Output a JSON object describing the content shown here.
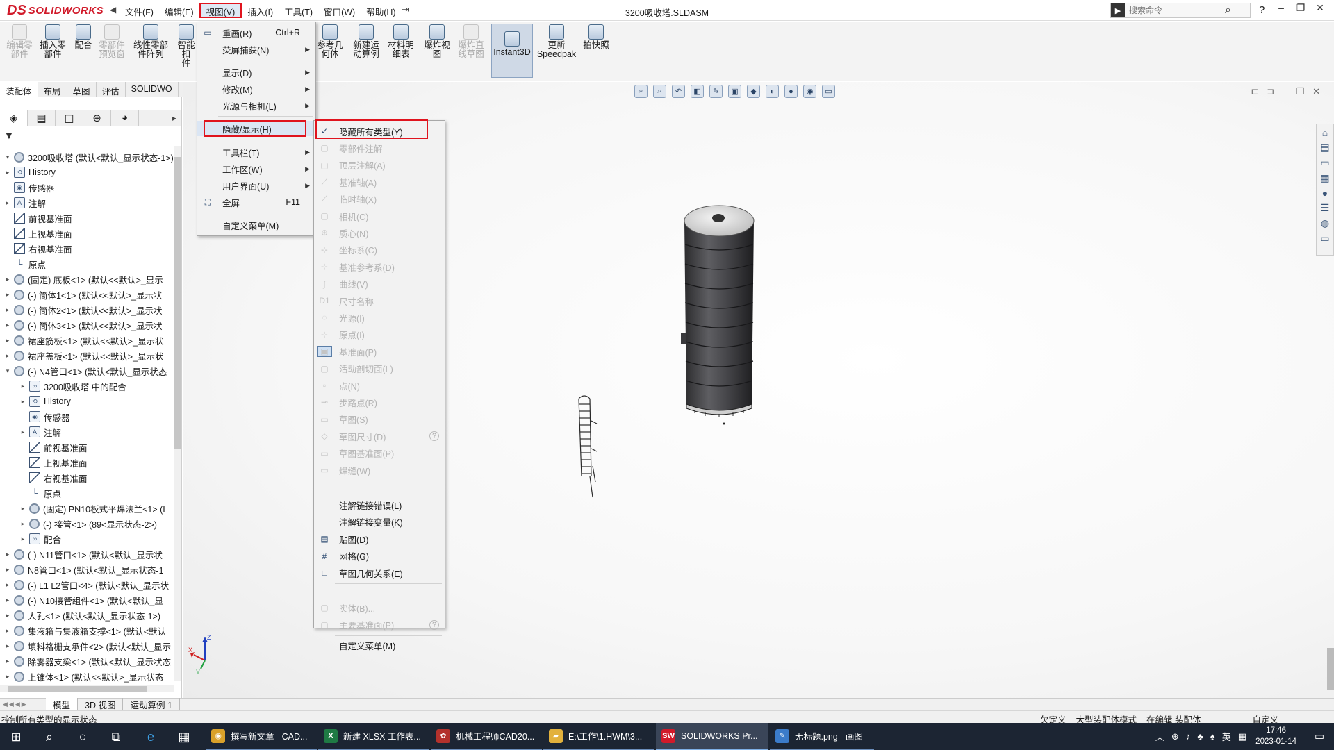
{
  "app": {
    "logo_ds": "DS",
    "logo_text": "SOLIDWORKS",
    "document_title": "3200吸收塔.SLDASM",
    "search_placeholder": "搜索命令",
    "menus": [
      "文件(F)",
      "编辑(E)",
      "视图(V)",
      "插入(I)",
      "工具(T)",
      "窗口(W)",
      "帮助(H)"
    ],
    "active_menu": "视图(V)"
  },
  "toolbar": {
    "tools": [
      {
        "label1": "编辑零",
        "label2": "部件",
        "disabled": true
      },
      {
        "label1": "插入零",
        "label2": "部件",
        "disabled": false
      },
      {
        "label1": "配合",
        "label2": "",
        "disabled": false
      },
      {
        "label1": "零部件",
        "label2": "预览窗",
        "disabled": true
      },
      {
        "label1": "线性零部",
        "label2": "件阵列",
        "disabled": false
      },
      {
        "label1": "智能扣",
        "label2": "件",
        "disabled": false
      },
      {
        "label1": "参考几",
        "label2": "何体",
        "disabled": false
      },
      {
        "label1": "新建运",
        "label2": "动算例",
        "disabled": false
      },
      {
        "label1": "材料明",
        "label2": "细表",
        "disabled": false
      },
      {
        "label1": "爆炸视",
        "label2": "图",
        "disabled": false
      },
      {
        "label1": "爆炸直",
        "label2": "线草图",
        "disabled": true
      },
      {
        "label1": "Instant3D",
        "label2": "",
        "disabled": false,
        "pressed": true
      },
      {
        "label1": "更新",
        "label2": "Speedpak",
        "disabled": false
      },
      {
        "label1": "拍快照",
        "label2": "",
        "disabled": false
      }
    ],
    "tabs": [
      "装配体",
      "布局",
      "草图",
      "评估",
      "SOLIDWO"
    ]
  },
  "view_menu": {
    "items": [
      {
        "label": "重画(R)",
        "shortcut": "Ctrl+R",
        "icon": "redraw-icon"
      },
      {
        "label": "荧屏捕获(N)",
        "submenu": true
      },
      {
        "label": "显示(D)",
        "submenu": true
      },
      {
        "label": "修改(M)",
        "submenu": true
      },
      {
        "label": "光源与相机(L)",
        "submenu": true
      },
      {
        "label": "隐藏/显示(H)",
        "submenu": false,
        "highlighted": true
      },
      {
        "label": "工具栏(T)",
        "submenu": true
      },
      {
        "label": "工作区(W)",
        "submenu": true
      },
      {
        "label": "用户界面(U)",
        "submenu": true
      },
      {
        "label": "全屏",
        "shortcut": "F11",
        "icon": "fullscreen-icon"
      },
      {
        "label": "自定义菜单(M)"
      }
    ]
  },
  "hide_show_menu": {
    "items": [
      {
        "label": "隐藏所有类型(Y)",
        "checked": true
      },
      {
        "label": "零部件注解",
        "disabled": true
      },
      {
        "label": "顶层注解(A)",
        "disabled": true
      },
      {
        "label": "基准轴(A)",
        "disabled": true
      },
      {
        "label": "临时轴(X)",
        "disabled": true
      },
      {
        "label": "相机(C)",
        "disabled": true
      },
      {
        "label": "质心(N)",
        "disabled": true
      },
      {
        "label": "坐标系(C)",
        "disabled": true
      },
      {
        "label": "基准参考系(D)",
        "disabled": true
      },
      {
        "label": "曲线(V)",
        "disabled": true
      },
      {
        "label": "尺寸名称",
        "disabled": true
      },
      {
        "label": "光源(I)",
        "disabled": true
      },
      {
        "label": "原点(I)",
        "disabled": true
      },
      {
        "label": "基准面(P)",
        "disabled": true
      },
      {
        "label": "活动剖切面(L)",
        "disabled": true
      },
      {
        "label": "点(N)",
        "disabled": true
      },
      {
        "label": "步路点(R)",
        "disabled": true
      },
      {
        "label": "草图(S)",
        "disabled": true
      },
      {
        "label": "草图尺寸(D)",
        "disabled": true
      },
      {
        "label": "草图基准面(P)",
        "disabled": true
      },
      {
        "label": "焊缝(W)",
        "disabled": true
      },
      {
        "label": "注解链接错误(L)",
        "disabled": false
      },
      {
        "label": "注解链接变量(K)",
        "disabled": false
      },
      {
        "label": "贴图(D)",
        "disabled": false
      },
      {
        "label": "网格(G)",
        "disabled": false
      },
      {
        "label": "草图几何关系(E)",
        "disabled": false
      },
      {
        "label": "实体(B)...",
        "disabled": true
      },
      {
        "label": "主要基准面(P)",
        "disabled": true
      },
      {
        "label": "自定义菜单(M)",
        "disabled": false
      }
    ]
  },
  "feature_tree": {
    "rows": [
      {
        "label": "3200吸收塔 (默认<默认_显示状态-1>)",
        "icon": "assembly",
        "indent": 0,
        "expand": "open"
      },
      {
        "label": "History",
        "icon": "history",
        "indent": 0,
        "expand": "closed"
      },
      {
        "label": "传感器",
        "icon": "sensor",
        "indent": 0,
        "expand": ""
      },
      {
        "label": "注解",
        "icon": "annotation",
        "indent": 0,
        "expand": "closed"
      },
      {
        "label": "前视基准面",
        "icon": "plane",
        "indent": 0,
        "expand": ""
      },
      {
        "label": "上视基准面",
        "icon": "plane",
        "indent": 0,
        "expand": ""
      },
      {
        "label": "右视基准面",
        "icon": "plane",
        "indent": 0,
        "expand": ""
      },
      {
        "label": "原点",
        "icon": "origin",
        "indent": 0,
        "expand": ""
      },
      {
        "label": "(固定) 底板<1> (默认<<默认>_显示",
        "icon": "part",
        "indent": 0,
        "expand": "closed"
      },
      {
        "label": "(-) 筒体1<1> (默认<<默认>_显示状",
        "icon": "part",
        "indent": 0,
        "expand": "closed"
      },
      {
        "label": "(-) 筒体2<1> (默认<<默认>_显示状",
        "icon": "part",
        "indent": 0,
        "expand": "closed"
      },
      {
        "label": "(-) 筒体3<1> (默认<<默认>_显示状",
        "icon": "part",
        "indent": 0,
        "expand": "closed"
      },
      {
        "label": "裙座筋板<1> (默认<<默认>_显示状",
        "icon": "part",
        "indent": 0,
        "expand": "closed"
      },
      {
        "label": "裙座盖板<1> (默认<<默认>_显示状",
        "icon": "part",
        "indent": 0,
        "expand": "closed"
      },
      {
        "label": "(-) N4管口<1> (默认<默认_显示状态",
        "icon": "subassembly",
        "indent": 0,
        "expand": "open"
      },
      {
        "label": "3200吸收塔 中的配合",
        "icon": "mates",
        "indent": 1,
        "expand": "closed"
      },
      {
        "label": "History",
        "icon": "history",
        "indent": 1,
        "expand": "closed"
      },
      {
        "label": "传感器",
        "icon": "sensor",
        "indent": 1,
        "expand": ""
      },
      {
        "label": "注解",
        "icon": "annotation",
        "indent": 1,
        "expand": "closed"
      },
      {
        "label": "前视基准面",
        "icon": "plane",
        "indent": 1,
        "expand": ""
      },
      {
        "label": "上视基准面",
        "icon": "plane",
        "indent": 1,
        "expand": ""
      },
      {
        "label": "右视基准面",
        "icon": "plane",
        "indent": 1,
        "expand": ""
      },
      {
        "label": "原点",
        "icon": "origin",
        "indent": 1,
        "expand": ""
      },
      {
        "label": "(固定) PN10板式平焊法兰<1> (I",
        "icon": "part",
        "indent": 1,
        "expand": "closed"
      },
      {
        "label": "(-) 接管<1> (89<显示状态-2>)",
        "icon": "part",
        "indent": 1,
        "expand": "closed"
      },
      {
        "label": "配合",
        "icon": "mates",
        "indent": 1,
        "expand": "closed"
      },
      {
        "label": "(-) N11管口<1> (默认<默认_显示状",
        "icon": "subassembly",
        "indent": 0,
        "expand": "closed"
      },
      {
        "label": "N8管口<1> (默认<默认_显示状态-1",
        "icon": "subassembly",
        "indent": 0,
        "expand": "closed"
      },
      {
        "label": "(-) L1 L2管口<4> (默认<默认_显示状",
        "icon": "subassembly",
        "indent": 0,
        "expand": "closed"
      },
      {
        "label": "(-) N10接管组件<1> (默认<默认_显",
        "icon": "subassembly",
        "indent": 0,
        "expand": "closed"
      },
      {
        "label": "人孔<1> (默认<默认_显示状态-1>)",
        "icon": "subassembly",
        "indent": 0,
        "expand": "closed"
      },
      {
        "label": "集液箱与集液箱支撑<1> (默认<默认",
        "icon": "subassembly",
        "indent": 0,
        "expand": "closed"
      },
      {
        "label": "填料格栅支承件<2> (默认<默认_显示",
        "icon": "subassembly",
        "indent": 0,
        "expand": "closed"
      },
      {
        "label": "除雾器支梁<1> (默认<默认_显示状态",
        "icon": "subassembly",
        "indent": 0,
        "expand": "closed"
      },
      {
        "label": "上锥体<1> (默认<<默认>_显示状态",
        "icon": "part",
        "indent": 0,
        "expand": "closed"
      }
    ]
  },
  "bottom_tabs": [
    "模型",
    "3D 视图",
    "运动算例 1"
  ],
  "status": {
    "message": "控制所有类型的显示状态",
    "under_defined": "欠定义",
    "large_mode": "大型装配体模式",
    "editing": "在编辑 装配体",
    "custom": "自定义"
  },
  "triad": {
    "x": "X",
    "y": "Y",
    "z": "Z"
  },
  "taskbar": {
    "apps": [
      {
        "label": "撰写新文章 - CAD...",
        "icon": "chrome-icon",
        "color": "#d9a12a"
      },
      {
        "label": "新建 XLSX 工作表...",
        "icon": "excel-icon",
        "color": "#1f7a44"
      },
      {
        "label": "机械工程师CAD20...",
        "icon": "cad-icon",
        "color": "#b3312c"
      },
      {
        "label": "E:\\工作\\1.HWM\\3...",
        "icon": "folder-icon",
        "color": "#e2b13c"
      },
      {
        "label": "SOLIDWORKS Pr...",
        "icon": "solidworks-icon",
        "color": "#d11a2a",
        "active": true
      },
      {
        "label": "无标题.png - 画图",
        "icon": "paint-icon",
        "color": "#3b7bc9"
      }
    ],
    "ime": "英",
    "time": "17:46",
    "date": "2023-01-14"
  }
}
